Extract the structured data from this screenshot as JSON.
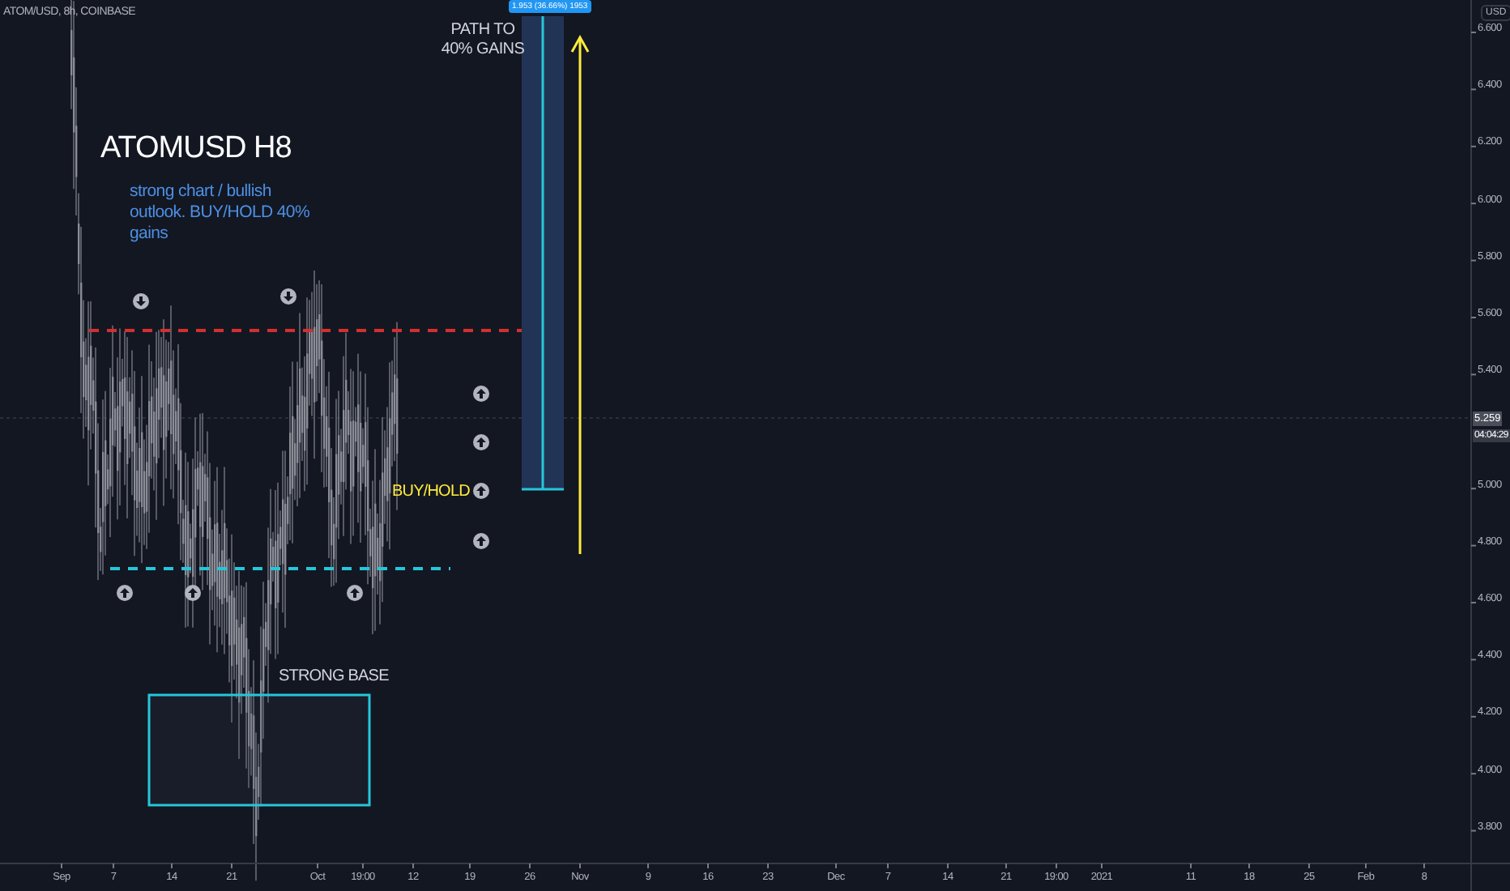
{
  "symbol_header": "ATOM/USD, 8h, COINBASE",
  "title": "ATOMUSD H8",
  "subtitle": "strong chart / bullish outlook. BUY/HOLD 40% gains",
  "target_note": "PATH TO 40% GAINS",
  "measure_label": "1.953 (36.66%) 1953",
  "signal_label": "BUY/HOLD",
  "base_label": "STRONG BASE",
  "markers": [
    {
      "kind": "down"
    },
    {
      "kind": "down"
    },
    {
      "kind": "up"
    },
    {
      "kind": "up"
    },
    {
      "kind": "up"
    },
    {
      "kind": "up"
    },
    {
      "kind": "up"
    },
    {
      "kind": "up"
    },
    {
      "kind": "up"
    }
  ],
  "price_axis": {
    "currency": "USD",
    "ticks": [
      "6.600",
      "6.400",
      "6.200",
      "6.000",
      "5.800",
      "5.600",
      "5.400",
      "5.000",
      "4.800",
      "4.600",
      "4.400",
      "4.200",
      "4.000",
      "3.800"
    ],
    "last_price": "5.259",
    "countdown": "04:04:29"
  },
  "time_axis": {
    "labels": [
      "Sep",
      "7",
      "14",
      "21",
      "Oct",
      "19:00",
      "12",
      "19",
      "26",
      "Nov",
      "9",
      "16",
      "23",
      "Dec",
      "7",
      "14",
      "21",
      "19:00",
      "2021",
      "11",
      "18",
      "25",
      "Feb",
      "8"
    ]
  }
}
